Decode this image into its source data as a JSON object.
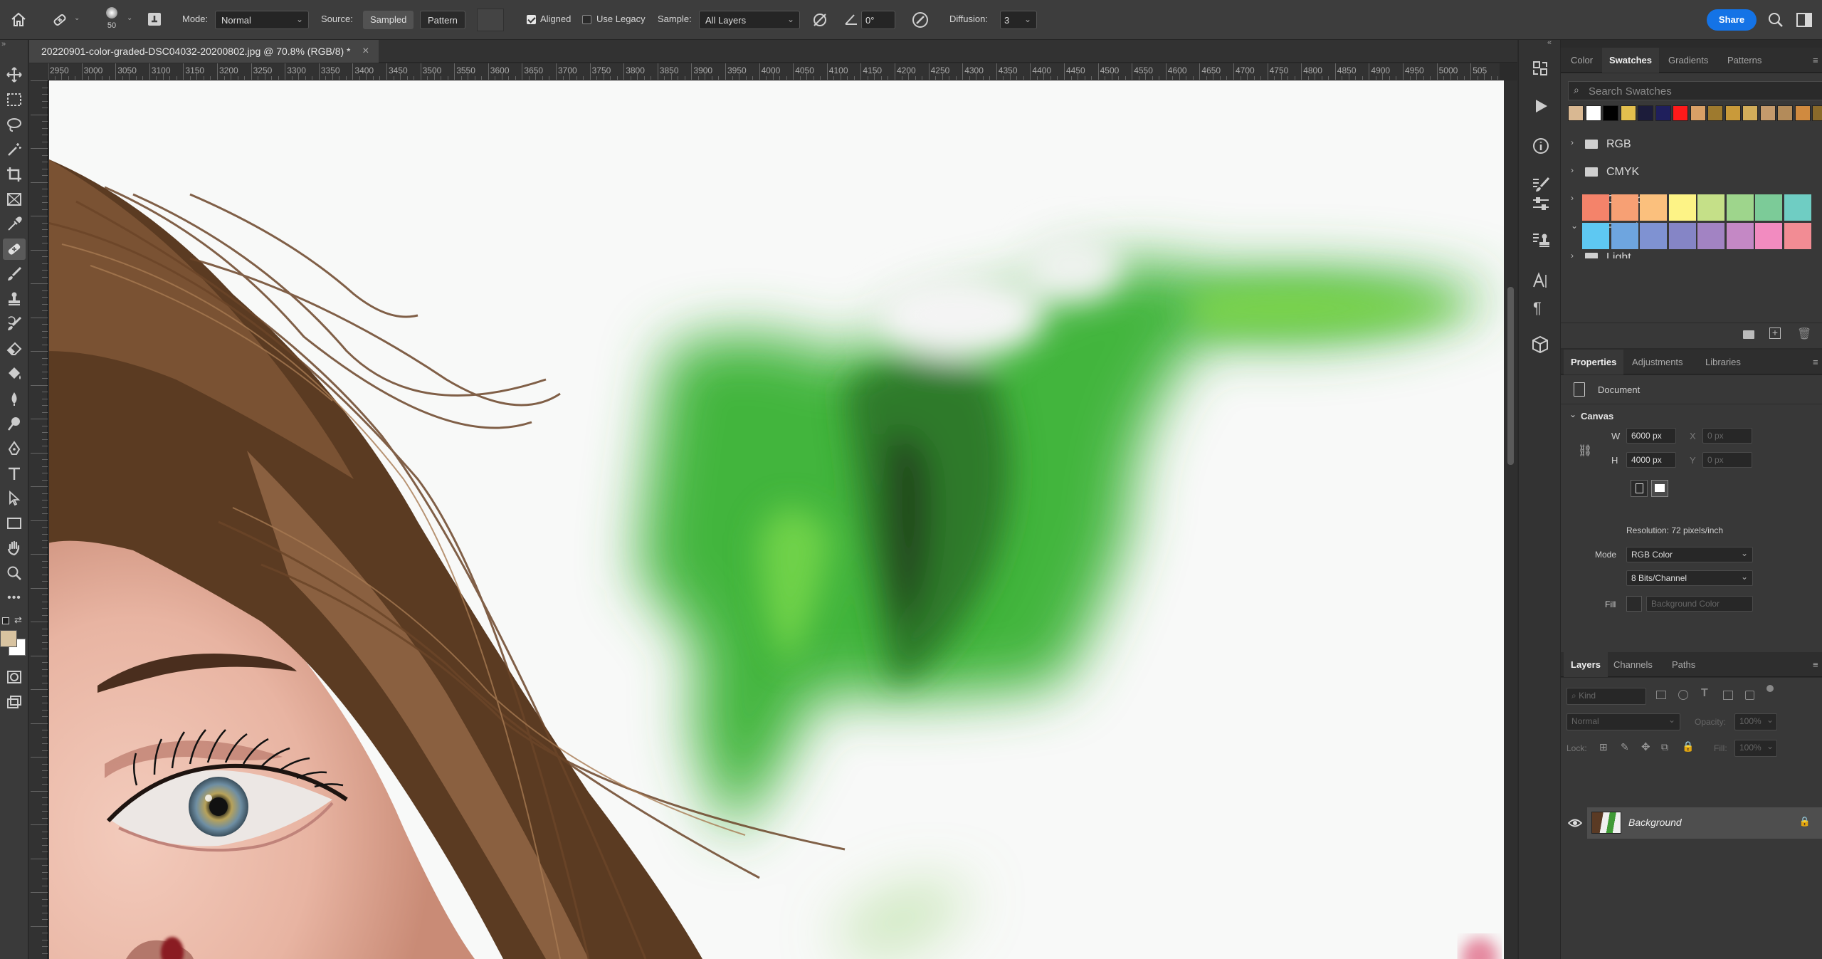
{
  "options_bar": {
    "brush_size": "50",
    "mode_label": "Mode:",
    "mode_value": "Normal",
    "source_label": "Source:",
    "source_sampled": "Sampled",
    "source_pattern": "Pattern",
    "aligned_label": "Aligned",
    "aligned_checked": true,
    "legacy_label": "Use Legacy",
    "legacy_checked": false,
    "sample_label": "Sample:",
    "sample_value": "All Layers",
    "angle_value": "0°",
    "diffusion_label": "Diffusion:",
    "diffusion_value": "3",
    "share_label": "Share",
    "share_color": "#1473e6"
  },
  "document": {
    "tab_title": "20220901-color-graded-DSC04032-20200802.jpg @ 70.8% (RGB/8) *",
    "close_symbol": "×"
  },
  "ruler": {
    "ticks": [
      "2950",
      "3000",
      "3050",
      "3100",
      "3150",
      "3200",
      "3250",
      "3300",
      "3350",
      "3400",
      "3450",
      "3500",
      "3550",
      "3600",
      "3650",
      "3700",
      "3750",
      "3800",
      "3850",
      "3900",
      "3950",
      "4000",
      "4050",
      "4100",
      "4150",
      "4200",
      "4250",
      "4300",
      "4350",
      "4400",
      "4450",
      "4500",
      "4550",
      "4600",
      "4650",
      "4700",
      "4750",
      "4800",
      "4850",
      "4900",
      "4950",
      "5000",
      "505"
    ]
  },
  "toolbar": {
    "tools": [
      "move-icon",
      "marquee-icon",
      "lasso-icon",
      "magic-wand-icon",
      "crop-icon",
      "frame-icon",
      "eyedropper-icon",
      "healing-brush-icon",
      "brush-icon",
      "clone-stamp-icon",
      "history-brush-icon",
      "eraser-icon",
      "paint-bucket-icon",
      "blur-icon",
      "dodge-icon",
      "pen-icon",
      "type-icon",
      "path-selection-icon",
      "rectangle-icon",
      "hand-icon",
      "zoom-icon",
      "more-tools-icon"
    ],
    "active_tool": "healing-brush-icon",
    "foreground_color": "#d8c3a0",
    "background_color": "#ffffff"
  },
  "swatches_panel": {
    "tabs": [
      "Color",
      "Swatches",
      "Gradients",
      "Patterns"
    ],
    "active_tab": "Swatches",
    "search_placeholder": "Search Swatches",
    "recent": [
      "#d9b892",
      "#ffffff",
      "#000000",
      "#e3bf4e",
      "#1c1c3a",
      "#1f1f5c",
      "#ff1a1a",
      "#d9a066",
      "#9e7a2e",
      "#c99a3a",
      "#d2ad5a",
      "#c49a6c",
      "#b38b5a",
      "#d08a3f",
      "#8a6a2a"
    ],
    "groups": [
      {
        "name": "RGB",
        "open": false
      },
      {
        "name": "CMYK",
        "open": false
      },
      {
        "name": "Grayscale",
        "open": false
      },
      {
        "name": "Pastel",
        "open": true
      },
      {
        "name": "Light",
        "open": false
      }
    ],
    "pastel_colors": [
      "#f4836a",
      "#f7a074",
      "#fbc07d",
      "#fdf386",
      "#c5e088",
      "#9ed58c",
      "#7ccb98",
      "#6fcdc3",
      "#5ec8f2",
      "#6ea5df",
      "#7f92d2",
      "#8585c6",
      "#a283c3",
      "#c488c5",
      "#f28bc0",
      "#f28c94"
    ]
  },
  "properties_panel": {
    "tabs": [
      "Properties",
      "Adjustments",
      "Libraries"
    ],
    "active_tab": "Properties",
    "doc_label": "Document",
    "canvas_label": "Canvas",
    "w_label": "W",
    "w_value": "6000 px",
    "h_label": "H",
    "h_value": "4000 px",
    "x_label": "X",
    "x_value": "0 px",
    "y_label": "Y",
    "y_value": "0 px",
    "resolution": "Resolution: 72 pixels/inch",
    "mode_label": "Mode",
    "mode_value": "RGB Color",
    "depth_value": "8 Bits/Channel",
    "fill_label": "Fill",
    "fill_value": "Background Color"
  },
  "layers_panel": {
    "tabs": [
      "Layers",
      "Channels",
      "Paths"
    ],
    "active_tab": "Layers",
    "kind_placeholder": "Kind",
    "blend_mode": "Normal",
    "opacity_label": "Opacity:",
    "opacity_value": "100%",
    "lock_label": "Lock:",
    "fill_label": "Fill:",
    "fill_value": "100%",
    "layers": [
      {
        "name": "Background",
        "visible": true,
        "locked": true
      }
    ]
  }
}
